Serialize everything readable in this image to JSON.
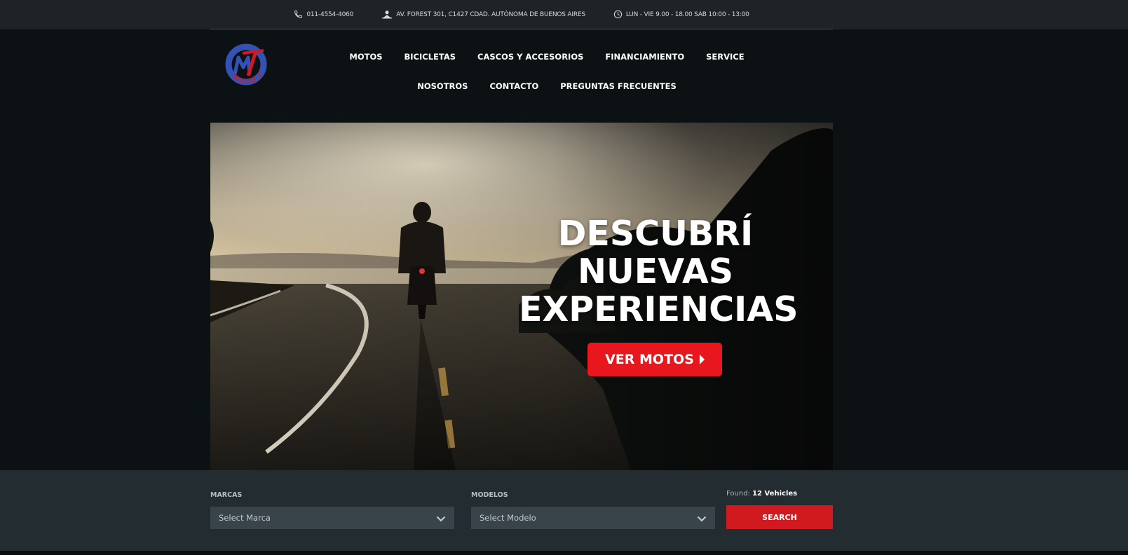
{
  "topbar": {
    "phone": "011-4554-4060",
    "address": "AV. FOREST 301, C1427 CDAD. AUTÓNOMA DE BUENOS AIRES",
    "hours": "LUN - VIE 9.00 - 18.00 SAB 10:00 - 13:00"
  },
  "logo": {
    "letters": "MT",
    "caption": "MOTOS TERRY"
  },
  "nav": {
    "items": [
      "MOTOS",
      "BICICLETAS",
      "CASCOS Y ACCESORIOS",
      "FINANCIAMIENTO",
      "SERVICE",
      "NOSOTROS",
      "CONTACTO",
      "PREGUNTAS FRECUENTES"
    ]
  },
  "hero": {
    "line1": "DESCUBRÍ",
    "line2": "NUEVAS",
    "line3": "EXPERIENCIAS",
    "button": "VER MOTOS"
  },
  "search": {
    "marcas_label": "MARCAS",
    "marcas_value": "Select Marca",
    "modelos_label": "MODELOS",
    "modelos_value": "Select Modelo",
    "found_label": "Found:",
    "found_count": "12 Vehicles",
    "button": "SEARCH"
  },
  "colors": {
    "accent": "#e8161d",
    "search_button": "#d11a1f",
    "page_bg": "#0c1114",
    "searchbar_bg": "#222c31"
  },
  "icons": [
    "phone-icon",
    "location-icon",
    "clock-icon",
    "chevron-down-icon",
    "caret-right-icon"
  ]
}
